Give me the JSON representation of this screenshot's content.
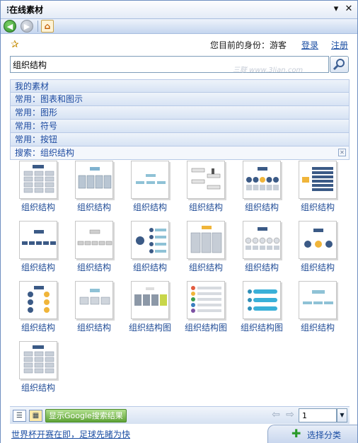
{
  "window": {
    "title": "在线素材",
    "dropdown_icon": "chevron-down-icon",
    "close_icon": "close-icon"
  },
  "nav": {
    "back_icon": "back-arrow-icon",
    "forward_icon": "forward-arrow-icon",
    "home_icon": "home-icon"
  },
  "identity": {
    "label": "您目前的身份：游客",
    "login": "登录",
    "register": "注册"
  },
  "search": {
    "value": "组织结构",
    "watermark": "三联 www.3lian.com"
  },
  "categories": [
    {
      "label": "我的素材"
    },
    {
      "label": "常用：图表和图示"
    },
    {
      "label": "常用：图形"
    },
    {
      "label": "常用：符号"
    },
    {
      "label": "常用：按钮"
    },
    {
      "label": "搜索：组织结构"
    }
  ],
  "results": [
    {
      "label": "组织结构",
      "style": "table"
    },
    {
      "label": "组织结构",
      "style": "grid"
    },
    {
      "label": "组织结构",
      "style": "minimal"
    },
    {
      "label": "组织结构",
      "style": "people"
    },
    {
      "label": "组织结构",
      "style": "circles"
    },
    {
      "label": "组织结构",
      "style": "list"
    },
    {
      "label": "组织结构",
      "style": "tree"
    },
    {
      "label": "组织结构",
      "style": "tree-light"
    },
    {
      "label": "组织结构",
      "style": "radial"
    },
    {
      "label": "组织结构",
      "style": "columns"
    },
    {
      "label": "组织结构",
      "style": "spheres"
    },
    {
      "label": "组织结构",
      "style": "balls"
    },
    {
      "label": "组织结构",
      "style": "vertical"
    },
    {
      "label": "组织结构",
      "style": "boxes"
    },
    {
      "label": "组织结构图",
      "style": "blocks"
    },
    {
      "label": "组织结构图",
      "style": "bullets"
    },
    {
      "label": "组织结构图",
      "style": "bars"
    },
    {
      "label": "组织结构",
      "style": "minimal2"
    },
    {
      "label": "组织结构",
      "style": "table"
    }
  ],
  "bottom": {
    "google_btn": "显示Google搜索结果",
    "page": "1"
  },
  "footer": {
    "tip": "世界杯开赛在即，足球先睹为快",
    "choose": "选择分类"
  },
  "colors": {
    "accent": "#1b4ea3",
    "frame": "#6f8fc0",
    "green": "#5ea237"
  }
}
